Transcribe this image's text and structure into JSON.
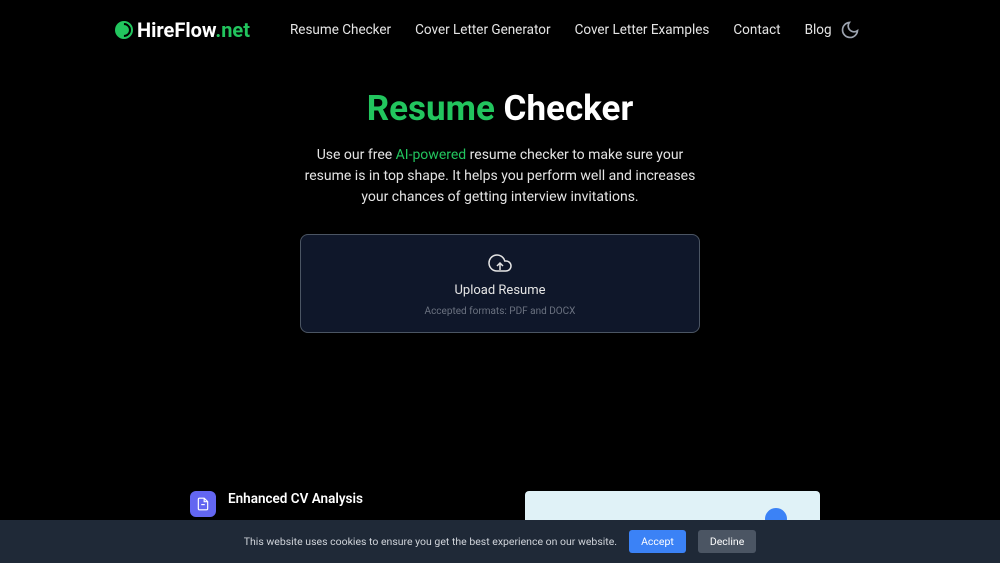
{
  "header": {
    "logo": {
      "prefix": "HireFlow",
      "suffix": ".net"
    },
    "nav": [
      "Resume Checker",
      "Cover Letter Generator",
      "Cover Letter Examples",
      "Contact",
      "Blog"
    ]
  },
  "hero": {
    "title_green": "Resume",
    "title_white": "Checker",
    "subtitle_pre": "Use our free ",
    "subtitle_highlight": "AI-powered",
    "subtitle_post": " resume checker to make sure your resume is in top shape. It helps you perform well and increases your chances of getting interview invitations."
  },
  "upload": {
    "label": "Upload Resume",
    "hint": "Accepted formats: PDF and DOCX"
  },
  "feature": {
    "title": "Enhanced CV Analysis"
  },
  "cookie": {
    "text": "This website uses cookies to ensure you get the best experience on our website.",
    "accept": "Accept",
    "decline": "Decline"
  }
}
